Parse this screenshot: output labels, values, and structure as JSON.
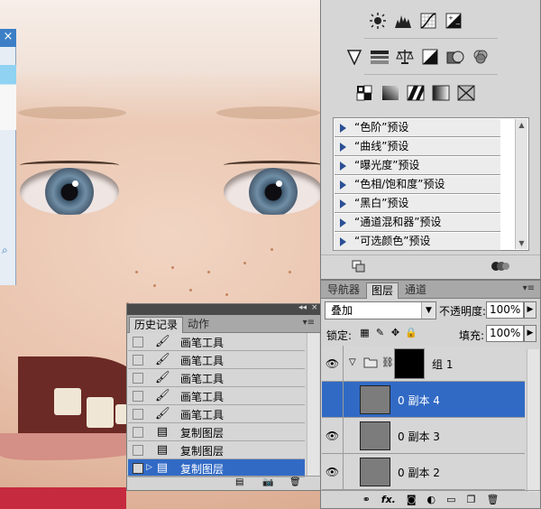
{
  "adjustments": {
    "row1_icons": [
      "brightness-icon",
      "levels-icon",
      "curves-icon",
      "exposure-icon"
    ],
    "row2_icons": [
      "vibrance-icon",
      "hue-saturation-icon",
      "color-balance-icon",
      "black-white-icon",
      "photo-filter-icon",
      "channel-mixer-icon"
    ],
    "row3_icons": [
      "invert-icon",
      "posterize-icon",
      "threshold-icon",
      "gradient-map-icon",
      "selective-color-icon"
    ],
    "presets": [
      "“色阶”预设",
      "“曲线”预设",
      "“曝光度”预设",
      "“色相/饱和度”预设",
      "“黑白”预设",
      "“通道混和器”预设",
      "“可选颜色”预设"
    ]
  },
  "layers_panel": {
    "tabs": [
      "导航器",
      "图层",
      "通道"
    ],
    "active_tab": "图层",
    "blend_mode": "叠加",
    "opacity_label": "不透明度:",
    "opacity_value": "100%",
    "lock_label": "锁定:",
    "fill_label": "填充:",
    "fill_value": "100%",
    "group": {
      "name": "组 1"
    },
    "layers": [
      {
        "name": "0 副本 4",
        "selected": true,
        "visible": false
      },
      {
        "name": "0 副本 3",
        "selected": false,
        "visible": true
      },
      {
        "name": "0 副本 2",
        "selected": false,
        "visible": true
      }
    ]
  },
  "history_panel": {
    "tabs": [
      "历史记录",
      "动作"
    ],
    "active_tab": "历史记录",
    "items": [
      {
        "label": "画笔工具",
        "icon": "brush-icon",
        "selected": false
      },
      {
        "label": "画笔工具",
        "icon": "brush-icon",
        "selected": false
      },
      {
        "label": "画笔工具",
        "icon": "brush-icon",
        "selected": false
      },
      {
        "label": "画笔工具",
        "icon": "brush-icon",
        "selected": false
      },
      {
        "label": "画笔工具",
        "icon": "brush-icon",
        "selected": false
      },
      {
        "label": "复制图层",
        "icon": "duplicate-layer-icon",
        "selected": false
      },
      {
        "label": "复制图层",
        "icon": "duplicate-layer-icon",
        "selected": false
      },
      {
        "label": "复制图层",
        "icon": "duplicate-layer-icon",
        "selected": true
      }
    ]
  },
  "colors": {
    "selection": "#316ac5",
    "panel_bg": "#d6d6d6",
    "preset_arrow": "#2a4f94"
  }
}
